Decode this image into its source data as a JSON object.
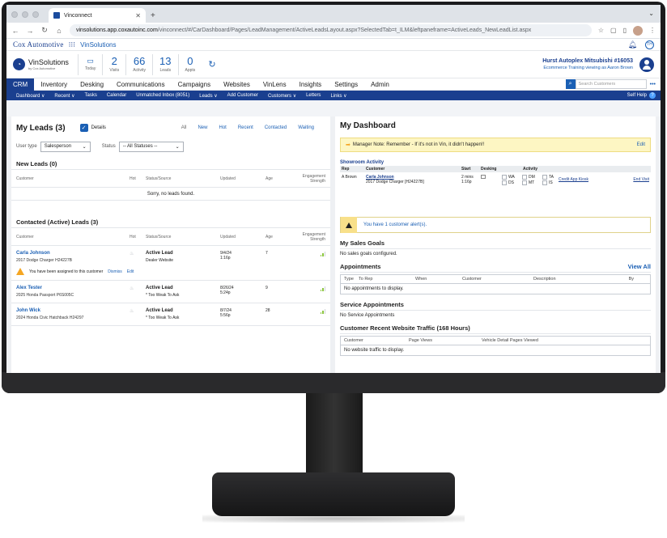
{
  "browser": {
    "tab_title": "Vinconnect",
    "url_host": "vinsolutions.app.coxautoinc.com",
    "url_path": "/vinconnect/#/CarDashboard/Pages/LeadManagement/ActiveLeadsLayout.aspx?SelectedTab=t_ILM&leftpaneframe=ActiveLeads_NewLeadList.aspx"
  },
  "brand": {
    "cox": "Cox Automotive",
    "product": "VinSolutions",
    "logo_name": "VinSolutions",
    "logo_sub": "by Cox Automotive",
    "avatar_initials": "TH"
  },
  "stats": [
    {
      "num": "",
      "label": "Today"
    },
    {
      "num": "2",
      "label": "Visits"
    },
    {
      "num": "66",
      "label": "Activity"
    },
    {
      "num": "13",
      "label": "Leads"
    },
    {
      "num": "0",
      "label": "Appts"
    }
  ],
  "dealer": {
    "name": "Hurst Autoplex Mitsubishi #16053",
    "sub": "Ecommerce Training viewing as Aaron Brown"
  },
  "main_nav": [
    "CRM",
    "Inventory",
    "Desking",
    "Communications",
    "Campaigns",
    "Websites",
    "VinLens",
    "Insights",
    "Settings",
    "Admin"
  ],
  "search": {
    "placeholder": "Search Customers"
  },
  "sub_nav": [
    "Dashboard ∨",
    "Recent ∨",
    "Tasks",
    "Calendar",
    "Unmatched Inbox (8051)",
    "Leads ∨",
    "Add Customer",
    "Customers ∨",
    "Letters",
    "Links ∨"
  ],
  "self_help": "Self Help",
  "leads": {
    "title": "My Leads (3)",
    "details_label": "Details",
    "filters": [
      "All",
      "New",
      "Hot",
      "Recent",
      "Contacted",
      "Waiting"
    ],
    "user_type_label": "User type",
    "user_type_value": "Salesperson",
    "status_label": "Status",
    "status_value": "-- All Statuses --",
    "new_title": "New Leads (0)",
    "columns": [
      "Customer",
      "Hot",
      "Status/Source",
      "Updated",
      "Age",
      "Engagement Strength"
    ],
    "empty_msg": "Sorry, no leads found.",
    "contacted_title": "Contacted (Active) Leads (3)",
    "rows": [
      {
        "name": "Carla Johnson",
        "vehicle": "2017 Dodge Charger H24227B",
        "status": "Active Lead",
        "source": "Dealer Website",
        "date": "9/4/24",
        "time": "1:16p",
        "age": "7",
        "assign": "You have been assigned to this customer",
        "dismiss": "Dismiss",
        "edit": "Edit"
      },
      {
        "name": "Alex Tester",
        "vehicle": "2025 Honda Passport P6S005C",
        "status": "Active Lead",
        "source": "* Too Weak To Ask",
        "date": "8/26/24",
        "time": "5:24p",
        "age": "9"
      },
      {
        "name": "John Wick",
        "vehicle": "2024 Honda Civic Hatchback H24297",
        "status": "Active Lead",
        "source": "* Too Weak To Ask",
        "date": "8/7/24",
        "time": "5:56p",
        "age": "28"
      }
    ]
  },
  "dashboard": {
    "title": "My Dashboard",
    "note": "Manager Note: Remember - If it's not in Vin, it didn't happen!!",
    "note_edit": "Edit",
    "showroom_title": "Showroom Activity",
    "showroom_cols": [
      "Rep",
      "Customer",
      "Start",
      "Desking",
      "Activity"
    ],
    "showroom_row": {
      "rep": "A Brown",
      "customer": "Carla Johnson",
      "vehicle": "2017 Dodge Charger [H24227B]",
      "start1": "2 mins",
      "start2": "1:16p",
      "activity": [
        "WA",
        "DM",
        "TA",
        "DS",
        "MT",
        "IS"
      ],
      "credit": "Credit App Kiosk",
      "end": "End Visit"
    },
    "alert": "You have 1 customer alert(s).",
    "goals_title": "My Sales Goals",
    "goals_text": "No sales goals configured.",
    "appt_title": "Appointments",
    "appt_view_all": "View All",
    "appt_cols": [
      "Type",
      "To Rep",
      "When",
      "Customer",
      "Description",
      "By"
    ],
    "appt_empty": "No appointments to display.",
    "service_title": "Service Appointments",
    "service_text": "No Service Appointments",
    "traffic_title": "Customer Recent Website Traffic (168 Hours)",
    "traffic_cols": [
      "Customer",
      "Page Views",
      "Vehicle Detail Pages Viewed"
    ],
    "traffic_empty": "No website traffic to display."
  },
  "colors": {
    "brand_blue": "#1a3f8f",
    "link_blue": "#1a5fb4",
    "note_yellow": "#fdf6c3",
    "warning": "#f5a623",
    "engagement_green": "#8cc63f"
  }
}
